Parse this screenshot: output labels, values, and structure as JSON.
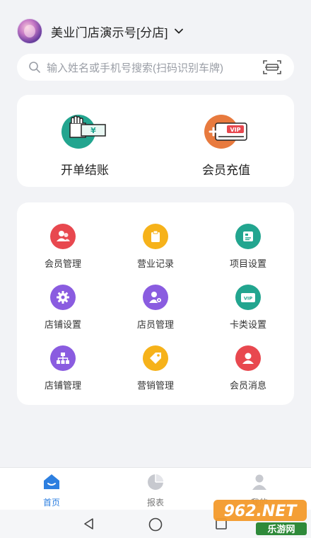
{
  "header": {
    "store_name": "美业门店演示号[分店]"
  },
  "search": {
    "placeholder": "输入姓名或手机号搜索(扫码识别车牌)"
  },
  "quick_actions": [
    {
      "label": "开单结账",
      "icon": "cash-hand-icon"
    },
    {
      "label": "会员充值",
      "icon": "vip-card-recharge-icon"
    }
  ],
  "grid": [
    {
      "label": "会员管理",
      "icon": "members-icon",
      "color": "#e8484f"
    },
    {
      "label": "营业记录",
      "icon": "clipboard-icon",
      "color": "#f6b21a"
    },
    {
      "label": "项目设置",
      "icon": "project-settings-icon",
      "color": "#22a58f"
    },
    {
      "label": "店铺设置",
      "icon": "gear-icon",
      "color": "#8a5ce0"
    },
    {
      "label": "店员管理",
      "icon": "staff-gear-icon",
      "color": "#8a5ce0"
    },
    {
      "label": "卡类设置",
      "icon": "vip-card-icon",
      "color": "#22a58f"
    },
    {
      "label": "店铺管理",
      "icon": "org-chart-icon",
      "color": "#8a5ce0"
    },
    {
      "label": "营销管理",
      "icon": "tag-icon",
      "color": "#f6b21a"
    },
    {
      "label": "会员消息",
      "icon": "member-message-icon",
      "color": "#e8484f"
    }
  ],
  "tabs": [
    {
      "label": "首页",
      "icon": "home-icon",
      "active": true
    },
    {
      "label": "报表",
      "icon": "pie-chart-icon",
      "active": false
    },
    {
      "label": "我的",
      "icon": "user-icon",
      "active": false
    }
  ],
  "watermark": {
    "brand": "962.NET",
    "subtitle": "乐游网"
  },
  "colors": {
    "accent": "#2d7fe0",
    "teal": "#22a58f",
    "red": "#e8484f",
    "yellow": "#f6b21a",
    "purple": "#8a5ce0",
    "background": "#f2f3f6"
  }
}
